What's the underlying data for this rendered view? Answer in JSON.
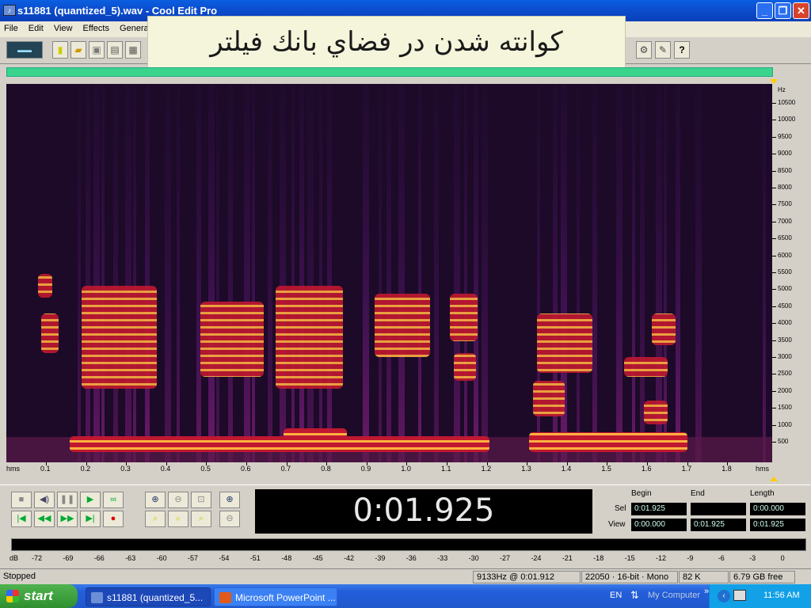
{
  "window": {
    "title": "s11881 (quantized_5).wav - Cool Edit Pro",
    "minimize_label": "_",
    "restore_label": "❐",
    "close_label": "✕"
  },
  "menu": [
    "File",
    "Edit",
    "View",
    "Effects",
    "Generate"
  ],
  "overlay_caption": "كوانته شدن در فضاي بانك فيلتر",
  "spectrogram": {
    "freq_unit": "Hz",
    "freq_ticks": [
      "10500",
      "10000",
      "9500",
      "9000",
      "8500",
      "8000",
      "7500",
      "7000",
      "6500",
      "6000",
      "5500",
      "5000",
      "4500",
      "4000",
      "3500",
      "3000",
      "2500",
      "2000",
      "1500",
      "1000",
      "500"
    ],
    "time_unit_left": "hms",
    "time_unit_right": "hms",
    "time_ticks": [
      "0.1",
      "0.2",
      "0.3",
      "0.4",
      "0.5",
      "0.6",
      "0.7",
      "0.8",
      "0.9",
      "1.0",
      "1.1",
      "1.2",
      "1.3",
      "1.4",
      "1.5",
      "1.6",
      "1.7",
      "1.8"
    ]
  },
  "transport": {
    "time_display": "0:01.925"
  },
  "selection": {
    "begin_header": "Begin",
    "end_header": "End",
    "length_header": "Length",
    "sel_label": "Sel",
    "view_label": "View",
    "sel_begin": "0:01.925",
    "sel_end": "",
    "sel_length": "0:00.000",
    "view_begin": "0:00.000",
    "view_end": "0:01.925",
    "view_length": "0:01.925"
  },
  "level_meter": {
    "unit": "dB",
    "ticks": [
      "-72",
      "-69",
      "-66",
      "-63",
      "-60",
      "-57",
      "-54",
      "-51",
      "-48",
      "-45",
      "-42",
      "-39",
      "-36",
      "-33",
      "-30",
      "-27",
      "-24",
      "-21",
      "-18",
      "-15",
      "-12",
      "-9",
      "-6",
      "-3",
      "0"
    ]
  },
  "status": {
    "state": "Stopped",
    "cursor": "9133Hz @  0:01.912",
    "format": "22050 · 16-bit · Mono",
    "size": "82 K",
    "free": "6.79 GB free"
  },
  "taskbar": {
    "start_label": "start",
    "tasks": [
      "s11881 (quantized_5...",
      "Microsoft PowerPoint ..."
    ],
    "language": "EN",
    "my_computer": "My Computer",
    "clock": "11:56 AM"
  },
  "colors": {
    "title_bar": "#0b4fd0",
    "spectrogram_bg": "#1c0a28",
    "spectrogram_hot": "#ff3010",
    "overview_bar": "#3ad48c"
  }
}
